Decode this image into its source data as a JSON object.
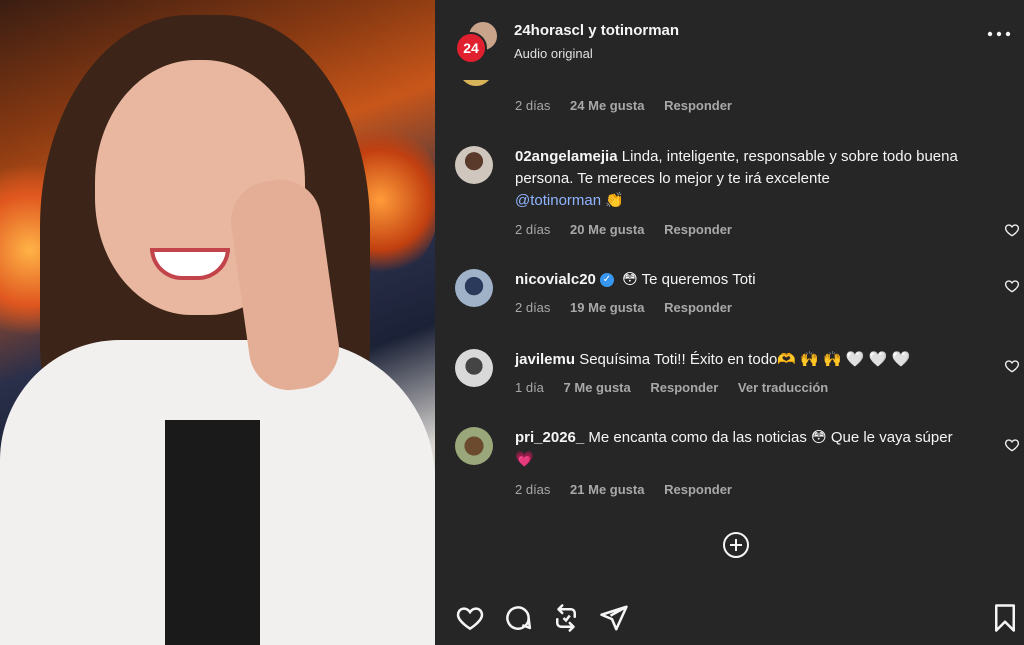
{
  "header": {
    "badge_text": "24",
    "names": "24horascl y totinorman",
    "audio": "Audio original",
    "more_icon": "more-horizontal-icon"
  },
  "partial_comment": {
    "time": "2 días",
    "likes": "24 Me gusta",
    "reply": "Responder"
  },
  "comments": [
    {
      "user": "02angelamejia",
      "text": "Linda, inteligente, responsable y sobre todo buena persona. Te mereces lo mejor y te irá excelente ",
      "mention": "@totinorman",
      "emoji": "👏",
      "time": "2 días",
      "likes": "20 Me gusta",
      "reply": "Responder"
    },
    {
      "user": "nicovialc20",
      "verified": true,
      "text": "😳 Te queremos Toti",
      "time": "2 días",
      "likes": "19 Me gusta",
      "reply": "Responder"
    },
    {
      "user": "javilemu",
      "text": "Sequísima Toti!! Éxito en todo🫶 🙌 🙌 🤍 🤍 🤍",
      "time": "1 día",
      "likes": "7 Me gusta",
      "reply": "Responder",
      "translate": "Ver traducción"
    },
    {
      "user": "pri_2026_",
      "text": "Me encanta como da las noticias 😳 Que le vaya súper 💗",
      "time": "2 días",
      "likes": "21 Me gusta",
      "reply": "Responder"
    }
  ],
  "colors": {
    "panel_bg": "#262626",
    "text": "#f5f5f5",
    "muted": "#a8a8a8",
    "mention": "#8fb4ff",
    "verified": "#3797f0",
    "badge": "#e0202f"
  },
  "icons": {
    "add_comment": "plus-circle-icon",
    "like": "heart-icon",
    "comment": "comment-icon",
    "repost": "repost-icon",
    "share": "send-icon",
    "save": "bookmark-icon"
  }
}
